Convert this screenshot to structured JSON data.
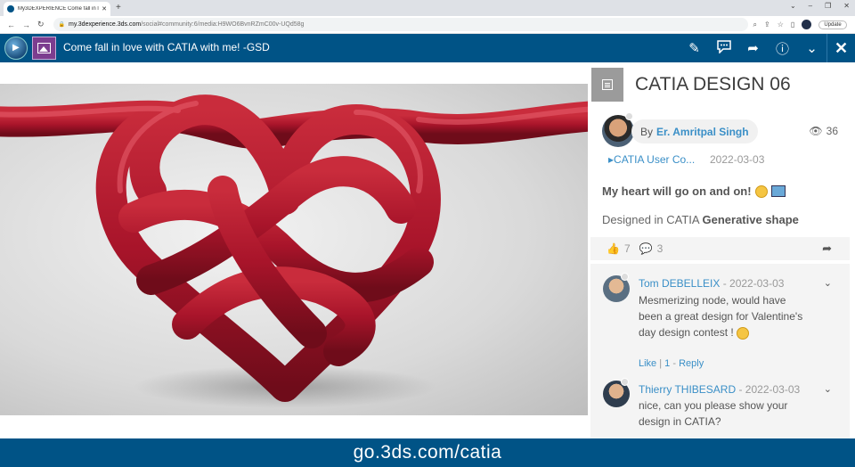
{
  "browser": {
    "tab_title": "My3DEXPERIENCE Come fall in l...",
    "new_tab": "+",
    "url_host": "my.3dexperience.3ds.com",
    "url_path": "/social#community:6/media:H9WO6BvnRZmC00v-UQd58g",
    "update_label": "Update"
  },
  "header": {
    "title": "Come fall in love with CATIA with me! -GSD"
  },
  "panel": {
    "title": "CATIA DESIGN 06",
    "by_prefix": "By",
    "author": "Er. Amritpal Singh",
    "views": "36",
    "community": "CATIA User Co...",
    "date": "2022-03-03",
    "body_line1": "My heart will go on and on!",
    "body_line2_plain": "Designed in CATIA",
    "body_line2_bold": "Generative shape",
    "likes": "7",
    "comment_count": "3"
  },
  "comments": [
    {
      "author": "Tom DEBELLEIX",
      "date": " - 2022-03-03",
      "text": "Mesmerizing node, would have been a great design for Valentine's day design contest !",
      "like_label": "Like",
      "like_count": "1",
      "reply_label": "Reply"
    },
    {
      "author": "Thierry THIBESARD",
      "date": " - 2022-03-03",
      "text": "nice, can you please show your design in CATIA?"
    }
  ],
  "footer": {
    "link": "go.3ds.com/catia"
  },
  "colors": {
    "brand_blue": "#005386",
    "link_blue": "#3a8fc7",
    "knot_red": "#b0182a"
  }
}
